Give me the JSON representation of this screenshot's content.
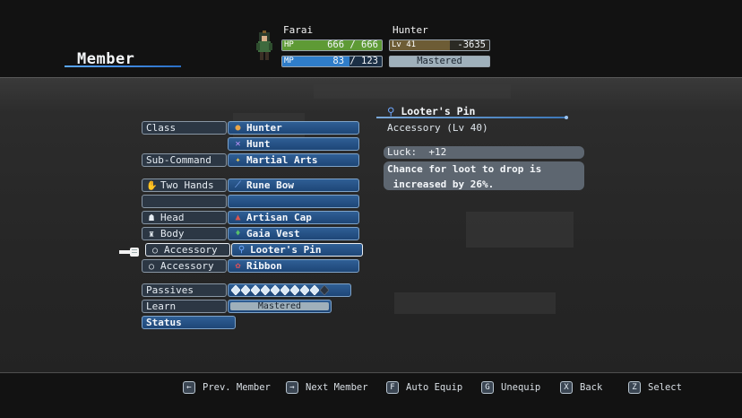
{
  "screen": {
    "title": "Member"
  },
  "character": {
    "name": "Farai",
    "hp": {
      "label": "HP",
      "current": "666",
      "sep": "/",
      "max": "666",
      "fraction": 1.0
    },
    "mp": {
      "label": "MP",
      "current": "83",
      "sep": "/",
      "max": "123",
      "fraction": 0.675
    }
  },
  "job": {
    "name": "Hunter",
    "level_label": "Lv",
    "level": "41",
    "exp": "-3635",
    "exp_fraction": 0.6,
    "mastery": "Mastered"
  },
  "rows": {
    "class": {
      "label": "Class",
      "value": "Hunter",
      "icon": "hunter-job-icon"
    },
    "command": {
      "value": "Hunt",
      "icon": "swords-icon"
    },
    "sub_command": {
      "label": "Sub-Command",
      "value": "Martial Arts",
      "icon": "martial-arts-icon"
    },
    "weapon": {
      "label": "Two Hands",
      "value": "Rune Bow",
      "icon": "bow-icon"
    },
    "head": {
      "label": "Head",
      "value": "Artisan Cap",
      "icon": "cap-icon"
    },
    "body": {
      "label": "Body",
      "value": "Gaia Vest",
      "icon": "vest-icon"
    },
    "accessory1": {
      "label": "Accessory",
      "value": "Looter's Pin",
      "icon": "pin-icon"
    },
    "accessory2": {
      "label": "Accessory",
      "value": "Ribbon",
      "icon": "ribbon-icon"
    },
    "passives": {
      "label": "Passives",
      "filled": 9,
      "total": 10
    },
    "learn": {
      "label": "Learn",
      "value": "Mastered"
    },
    "status": {
      "label": "Status"
    }
  },
  "detail": {
    "title": "Looter's Pin",
    "subtitle": "Accessory (Lv 40)",
    "stat": "Luck:  +12",
    "description_line1": "Chance for loot to drop is",
    "description_line2": " increased by 26%."
  },
  "footer": [
    {
      "key": "←",
      "label": "Prev. Member"
    },
    {
      "key": "→",
      "label": "Next Member"
    },
    {
      "key": "F",
      "label": "Auto Equip"
    },
    {
      "key": "G",
      "label": "Unequip"
    },
    {
      "key": "X",
      "label": "Back"
    },
    {
      "key": "Z",
      "label": "Select"
    }
  ],
  "colors": {
    "hp_fill": "#5e9a35",
    "mp_fill": "#2f7dc9",
    "exp_fill": "#6d5c35",
    "accent": "#4d9ef2"
  }
}
